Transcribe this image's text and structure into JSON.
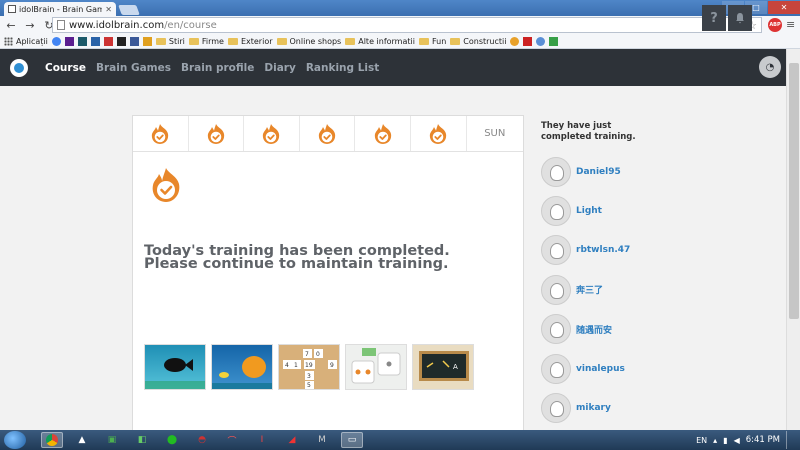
{
  "browser": {
    "tab_title": "idolBrain - Brain Games &",
    "url_host": "www.idolbrain.com",
    "url_path": "/en/course",
    "window_controls": [
      "–",
      "□",
      "✕"
    ]
  },
  "bookmarks": [
    {
      "label": "Aplicații",
      "icon": "apps-icon"
    },
    {
      "label": "",
      "icon": "g-icon"
    },
    {
      "label": "",
      "icon": "yahoo-icon"
    },
    {
      "label": "",
      "icon": "icon"
    },
    {
      "label": "",
      "icon": "t-icon"
    },
    {
      "label": "",
      "icon": "icon"
    },
    {
      "label": "",
      "icon": "icon"
    },
    {
      "label": "",
      "icon": "facebook-icon"
    },
    {
      "label": "",
      "icon": "icon"
    },
    {
      "label": "Stiri",
      "icon": "folder-icon"
    },
    {
      "label": "Firme",
      "icon": "folder-icon"
    },
    {
      "label": "Exterior",
      "icon": "folder-icon"
    },
    {
      "label": "Online shops",
      "icon": "folder-icon"
    },
    {
      "label": "Alte informatii",
      "icon": "folder-icon"
    },
    {
      "label": "Fun",
      "icon": "folder-icon"
    },
    {
      "label": "Constructii",
      "icon": "folder-icon"
    }
  ],
  "site_nav": {
    "links": [
      "Course",
      "Brain Games",
      "Brain profile",
      "Diary",
      "Ranking List"
    ],
    "active": "Course",
    "help_label": "?",
    "bell_label": "🔔"
  },
  "course": {
    "days": [
      "",
      "",
      "",
      "",
      "",
      "",
      "SUN"
    ],
    "completed_days": 6,
    "message": "Today's training has been completed. Please continue to maintain training.",
    "games": [
      "fish-game",
      "goldfish-game",
      "numbers-game",
      "dice-game",
      "blackboard-game"
    ]
  },
  "sidebar": {
    "title": "They have just completed training.",
    "users": [
      "Daniel95",
      "Light",
      "rbtwlsn.47",
      "奔三了",
      "随遇而安",
      "vinalepus",
      "mikary"
    ]
  },
  "taskbar": {
    "language": "EN",
    "time": "6:41 PM"
  },
  "colors": {
    "accent_orange": "#e8872a",
    "nav_bg": "#2d3238",
    "link_blue": "#2f7fc0"
  }
}
